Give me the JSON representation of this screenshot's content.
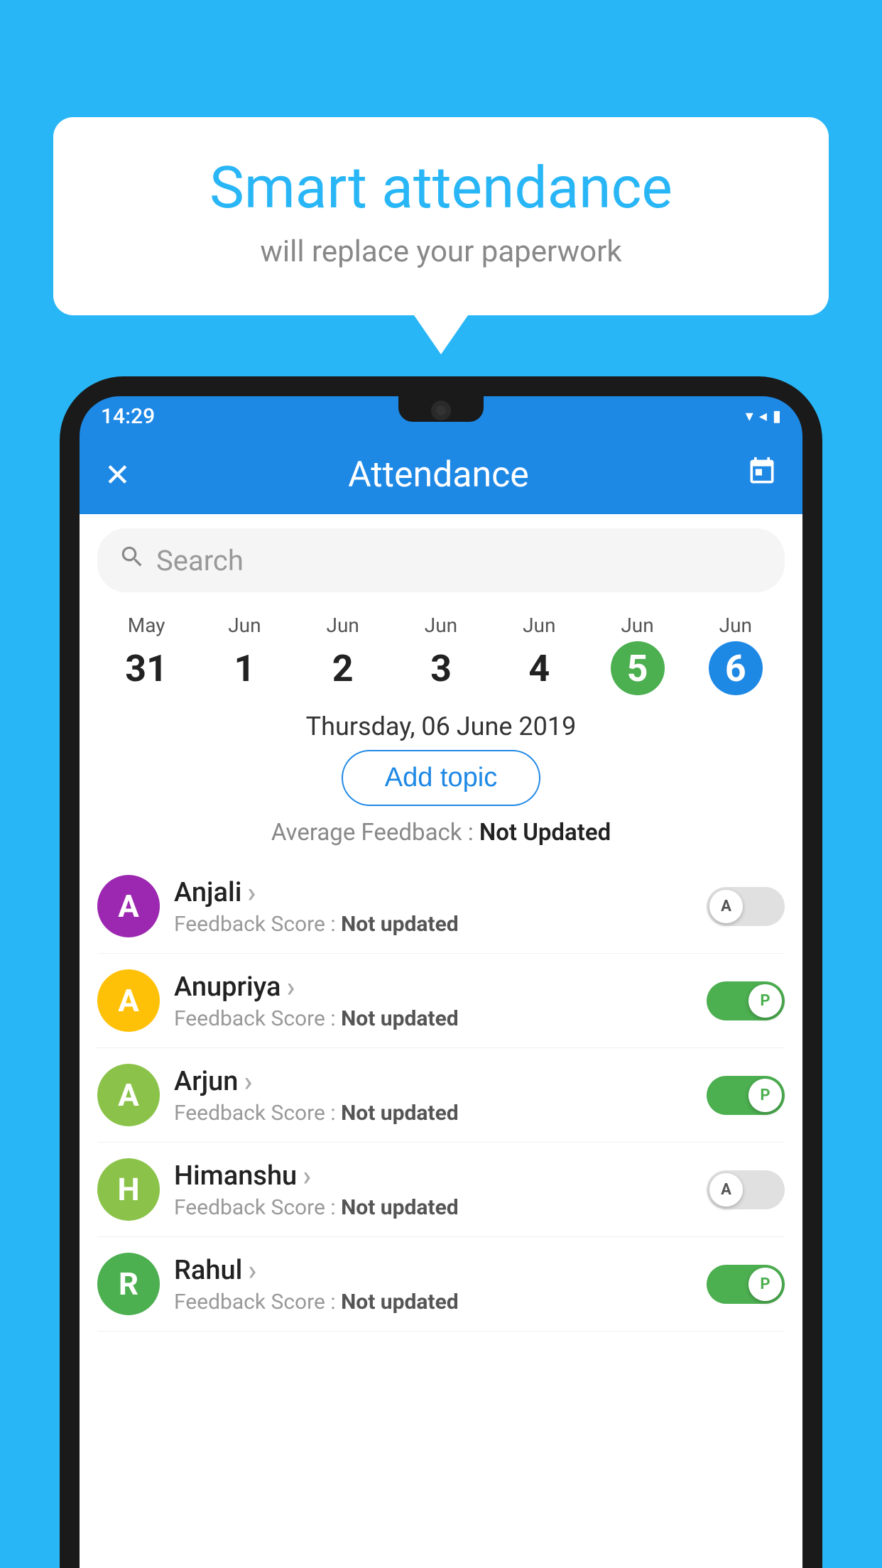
{
  "background_color": "#29B6F6",
  "bubble": {
    "title": "Smart attendance",
    "subtitle": "will replace your paperwork"
  },
  "status_bar": {
    "time": "14:29",
    "icons": [
      "▼",
      "◂",
      "▮"
    ]
  },
  "header": {
    "title": "Attendance",
    "close_label": "✕",
    "calendar_icon": "📅"
  },
  "search": {
    "placeholder": "Search"
  },
  "calendar": {
    "days": [
      {
        "month": "May",
        "date": "31",
        "state": "normal"
      },
      {
        "month": "Jun",
        "date": "1",
        "state": "normal"
      },
      {
        "month": "Jun",
        "date": "2",
        "state": "normal"
      },
      {
        "month": "Jun",
        "date": "3",
        "state": "normal"
      },
      {
        "month": "Jun",
        "date": "4",
        "state": "normal"
      },
      {
        "month": "Jun",
        "date": "5",
        "state": "today"
      },
      {
        "month": "Jun",
        "date": "6",
        "state": "selected"
      }
    ]
  },
  "selected_date": "Thursday, 06 June 2019",
  "add_topic_label": "Add topic",
  "avg_feedback_label": "Average Feedback :",
  "avg_feedback_value": "Not Updated",
  "students": [
    {
      "name": "Anjali",
      "initial": "A",
      "avatar_color": "#9C27B0",
      "feedback_label": "Feedback Score :",
      "feedback_value": "Not updated",
      "toggle": "off",
      "toggle_letter": "A"
    },
    {
      "name": "Anupriya",
      "initial": "A",
      "avatar_color": "#FFC107",
      "feedback_label": "Feedback Score :",
      "feedback_value": "Not updated",
      "toggle": "on",
      "toggle_letter": "P"
    },
    {
      "name": "Arjun",
      "initial": "A",
      "avatar_color": "#8BC34A",
      "feedback_label": "Feedback Score :",
      "feedback_value": "Not updated",
      "toggle": "on",
      "toggle_letter": "P"
    },
    {
      "name": "Himanshu",
      "initial": "H",
      "avatar_color": "#8BC34A",
      "feedback_label": "Feedback Score :",
      "feedback_value": "Not updated",
      "toggle": "off",
      "toggle_letter": "A"
    },
    {
      "name": "Rahul",
      "initial": "R",
      "avatar_color": "#4CAF50",
      "feedback_label": "Feedback Score :",
      "feedback_value": "Not updated",
      "toggle": "on",
      "toggle_letter": "P"
    }
  ]
}
